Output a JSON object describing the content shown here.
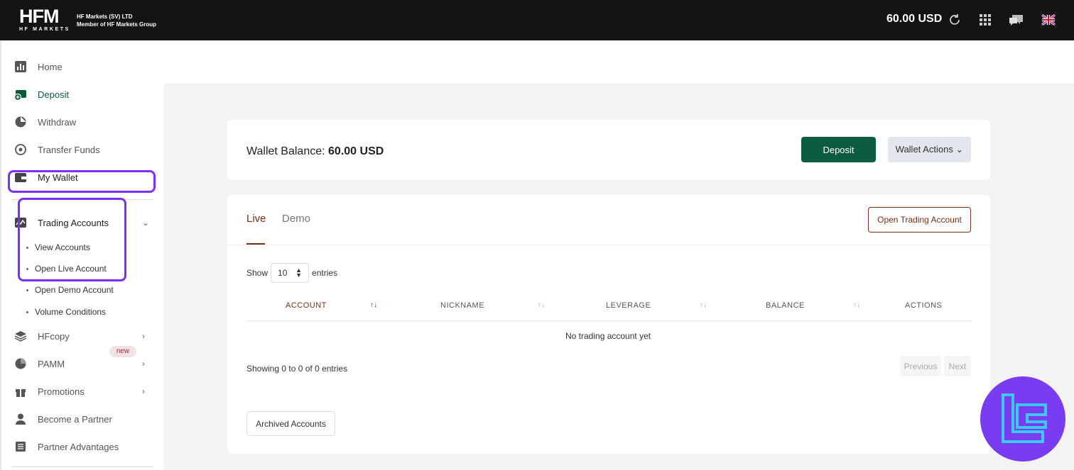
{
  "topbar": {
    "logo_text": "HFM",
    "logo_sub": "HF MARKETS",
    "company_line1": "HF Markets (SV) LTD",
    "company_line2": "Member of HF Markets Group",
    "balance": "60.00 USD",
    "icons": [
      "refresh-icon",
      "apps-grid-icon",
      "chat-icon",
      "uk-flag-icon"
    ]
  },
  "sidebar": {
    "items": [
      {
        "label": "Home",
        "icon": "bar-chart-icon"
      },
      {
        "label": "Deposit",
        "icon": "deposit-icon"
      },
      {
        "label": "Withdraw",
        "icon": "withdraw-icon"
      },
      {
        "label": "Transfer Funds",
        "icon": "transfer-icon"
      },
      {
        "label": "My Wallet",
        "icon": "wallet-icon"
      },
      {
        "label": "Trading Accounts",
        "icon": "trading-chart-icon"
      },
      {
        "label": "HFcopy",
        "icon": "layers-icon"
      },
      {
        "label": "PAMM",
        "icon": "pie-icon"
      },
      {
        "label": "Promotions",
        "icon": "gift-icon",
        "badge": "new"
      },
      {
        "label": "Become a Partner",
        "icon": "person-icon"
      },
      {
        "label": "Partner Advantages",
        "icon": "list-icon"
      }
    ],
    "trading_sub": [
      "View Accounts",
      "Open Live Account",
      "Open Demo Account",
      "Volume Conditions"
    ]
  },
  "wallet": {
    "label": "Wallet Balance:",
    "amount": "60.00 USD",
    "deposit_btn": "Deposit",
    "actions_btn": "Wallet Actions ⌄"
  },
  "accounts": {
    "tabs": [
      "Live",
      "Demo"
    ],
    "open_btn": "Open Trading Account",
    "show_label": "Show",
    "page_size": "10",
    "entries_label": "entries",
    "columns": [
      "ACCOUNT",
      "NICKNAME",
      "LEVERAGE",
      "BALANCE",
      "ACTIONS"
    ],
    "empty": "No trading account yet",
    "showing": "Showing 0 to 0 of 0 entries",
    "prev": "Previous",
    "next": "Next",
    "archived_btn": "Archived Accounts"
  },
  "colors": {
    "brand_green": "#0c5d3f",
    "accent_brown": "#7a2e12",
    "highlight_purple": "#7b2ff7"
  }
}
